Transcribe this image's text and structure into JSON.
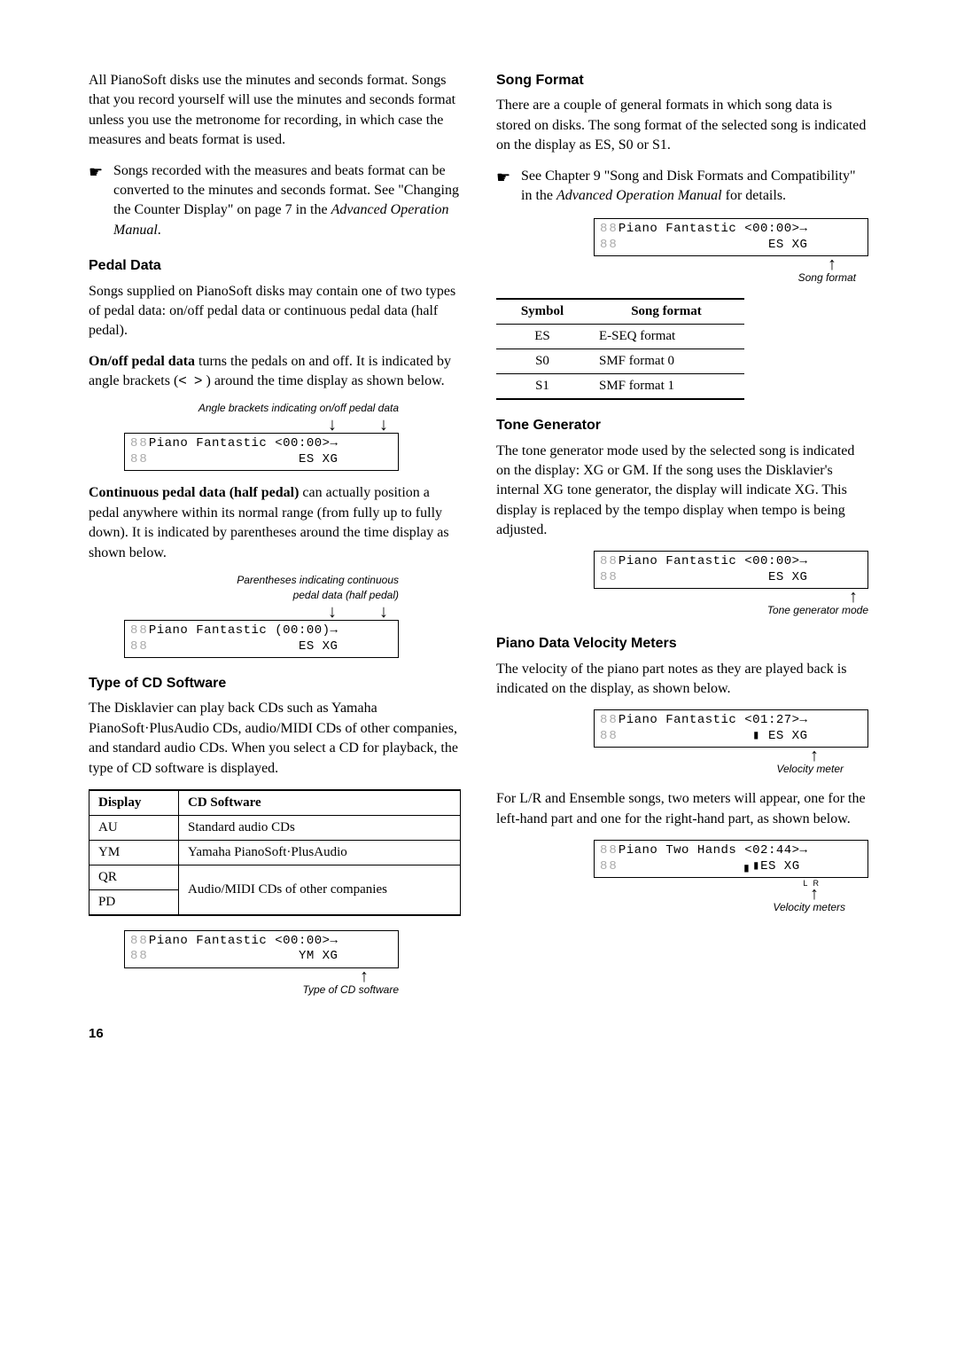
{
  "colLeft": {
    "intro": "All PianoSoft disks use the minutes and seconds format. Songs that you record yourself will use the minutes and seconds format unless you use the metronome for recording, in which case the measures and beats format is used.",
    "bullet1": {
      "marker": "☛",
      "text_a": "Songs recorded with the measures and beats format can be converted to the minutes and seconds format. See \"Changing the Counter Display\" on page 7 in the ",
      "text_b": "Advanced Operation Manual",
      "text_c": "."
    },
    "pedal": {
      "heading": "Pedal Data",
      "p1": "Songs supplied on PianoSoft disks may contain one of two types of pedal data: on/off pedal data or continuous pedal data (half pedal).",
      "p2a": "On/off pedal data",
      "p2b": " turns the pedals on and off. It is indicated by angle brackets (",
      "p2c": ") around the time display as shown below.",
      "lb": "<",
      "rb": ">",
      "caption1": "Angle brackets indicating on/off pedal data",
      "lcd1_l1": "Piano Fantastic <00:00>→",
      "lcd1_l2": "                   ES XG",
      "p3a": "Continuous pedal data (half pedal)",
      "p3b": " can actually position a pedal anywhere within its normal range (from fully up to fully down). It is indicated by parentheses  around the time display as shown below.",
      "caption2a": "Parentheses indicating continuous",
      "caption2b": "pedal data (half pedal)",
      "lcd2_l1": "Piano Fantastic (00:00)→",
      "lcd2_l2": "                   ES XG"
    },
    "cd": {
      "heading": "Type of CD Software",
      "p1": "The Disklavier can play back CDs such as Yamaha PianoSoft·PlusAudio CDs, audio/MIDI CDs of other companies, and standard audio CDs. When you select a CD for playback, the type of CD software is displayed.",
      "th1": "Display",
      "th2": "CD Software",
      "rows": [
        {
          "d": "AU",
          "s": "Standard audio CDs"
        },
        {
          "d": "YM",
          "s": "Yamaha PianoSoft·PlusAudio"
        },
        {
          "d": "QR",
          "s": ""
        },
        {
          "d": "PD",
          "s": "Audio/MIDI CDs of other companies"
        }
      ],
      "lcd_l1": "Piano Fantastic <00:00>→",
      "lcd_l2": "                   YM XG",
      "arrow_lbl": "Type of CD software"
    }
  },
  "colRight": {
    "song": {
      "heading": "Song Format",
      "p1": "There are a couple of general formats in which song data is stored on disks. The song format of the selected song is indicated on the display as ES, S0 or S1.",
      "bullet": {
        "marker": "☛",
        "a": "See Chapter 9 \"Song and Disk Formats and Compatibility\" in the ",
        "b": "Advanced Operation Manual",
        "c": " for details."
      },
      "lcd_l1": "Piano Fantastic <00:00>→",
      "lcd_l2": "                   ES XG",
      "arrow_lbl": "Song format",
      "th1": "Symbol",
      "th2": "Song format",
      "rows": [
        {
          "s": "ES",
          "f": "E-SEQ format"
        },
        {
          "s": "S0",
          "f": "SMF format 0"
        },
        {
          "s": "S1",
          "f": "SMF format 1"
        }
      ]
    },
    "tone": {
      "heading": "Tone Generator",
      "p1": "The tone generator mode used by the selected song is indicated on the display: XG or GM. If the song uses the Disklavier's internal XG tone generator, the display will indicate XG. This display is replaced by the tempo display when tempo is being adjusted.",
      "lcd_l1": "Piano Fantastic <00:00>→",
      "lcd_l2": "                   ES XG",
      "arrow_lbl": "Tone generator mode"
    },
    "vel": {
      "heading": "Piano Data Velocity Meters",
      "p1": "The velocity of the piano part notes as they are played back is indicated on the display, as shown below.",
      "lcd1_l1": "Piano Fantastic <01:27>→",
      "lcd1_l2": "                 ▮ ES XG",
      "arrow1_lbl": "Velocity meter",
      "p2": "For L/R and Ensemble songs, two meters will appear, one for the left-hand part and one for the right-hand part, as shown below.",
      "lcd2_l1": "Piano Two Hands <02:44>→",
      "lcd2_l2": "                ▖▮ES XG",
      "lr": "L R",
      "arrow2_lbl": "Velocity meters"
    }
  },
  "pageNum": "16",
  "ghost_digits": "88"
}
